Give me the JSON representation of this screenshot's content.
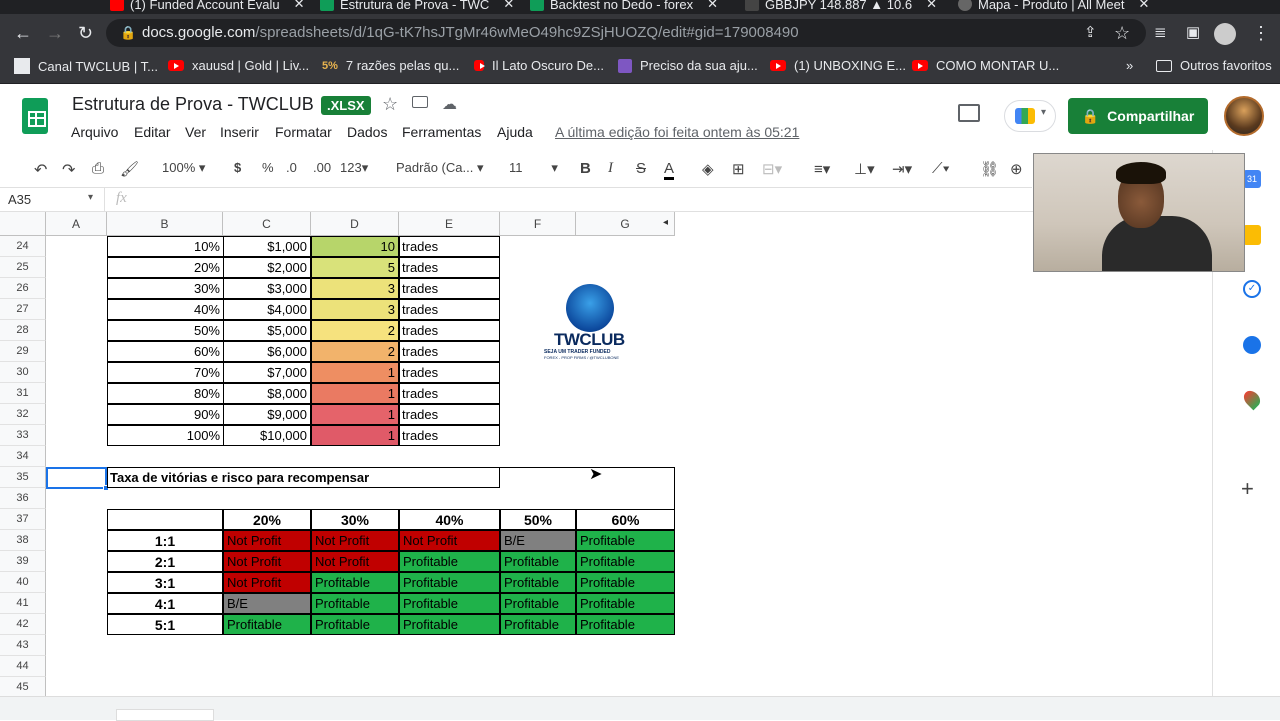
{
  "browser": {
    "tabs": [
      {
        "label": "(1) Funded Account Evalu",
        "color": "#ff0000"
      },
      {
        "label": "Estrutura de Prova - TWC",
        "color": "#0f9d58"
      },
      {
        "label": "Backtest no Dedo - forex",
        "color": "#0f9d58"
      },
      {
        "label": "GBBJPY 148.887 ▲ 10.6",
        "color": "#ffffff"
      },
      {
        "label": "Mapa - Produto | All Meet",
        "color": "#ffffff"
      }
    ],
    "url_host": "docs.google.com",
    "url_path": "/spreadsheets/d/1qG-tK7hsJTgMr46wMeO49hc9ZSjHUOZQ/edit#gid=179008490",
    "bookmarks": [
      "Canal TWCLUB | T...",
      "xauusd | Gold | Liv...",
      "7 razões pelas qu...",
      "Il Lato Oscuro De...",
      "Preciso da sua aju...",
      "(1) UNBOXING E...",
      "COMO MONTAR U..."
    ],
    "bookmarks_more": "»",
    "other_favorites": "Outros favoritos"
  },
  "sheet": {
    "title": "Estrutura de Prova - TWCLUB",
    "badge": ".XLSX",
    "menus": [
      "Arquivo",
      "Editar",
      "Ver",
      "Inserir",
      "Formatar",
      "Dados",
      "Ferramentas",
      "Ajuda"
    ],
    "last_edit": "A última edição foi feita ontem às 05:21",
    "share_label": "Compartilhar",
    "toolbar": {
      "zoom": "100%",
      "currency": "$",
      "percent": "%",
      "dec_dec": ".0",
      "dec_inc": ".00",
      "format_more": "123",
      "font": "Padrão (Ca...",
      "font_size": "11",
      "bold": "B",
      "italic": "I",
      "strike": "S",
      "textcolor": "A"
    },
    "name_box": "A35",
    "fx": "fx"
  },
  "grid": {
    "columns": [
      "A",
      "B",
      "C",
      "D",
      "E",
      "F",
      "G"
    ],
    "rows": [
      "24",
      "25",
      "26",
      "27",
      "28",
      "29",
      "30",
      "31",
      "32",
      "33",
      "34",
      "35",
      "36",
      "37",
      "38",
      "39",
      "40",
      "41",
      "42",
      "43",
      "44",
      "45"
    ],
    "risk_table": [
      {
        "pct": "10%",
        "amount": "$1,000",
        "trades": "10",
        "unit": "trades",
        "color": "#b7d56a"
      },
      {
        "pct": "20%",
        "amount": "$2,000",
        "trades": "5",
        "unit": "trades",
        "color": "#d9e27a"
      },
      {
        "pct": "30%",
        "amount": "$3,000",
        "trades": "3",
        "unit": "trades",
        "color": "#ece27a"
      },
      {
        "pct": "40%",
        "amount": "$4,000",
        "trades": "3",
        "unit": "trades",
        "color": "#ece27a"
      },
      {
        "pct": "50%",
        "amount": "$5,000",
        "trades": "2",
        "unit": "trades",
        "color": "#f6e27e"
      },
      {
        "pct": "60%",
        "amount": "$6,000",
        "trades": "2",
        "unit": "trades",
        "color": "#f2b36b"
      },
      {
        "pct": "70%",
        "amount": "$7,000",
        "trades": "1",
        "unit": "trades",
        "color": "#ee8e62"
      },
      {
        "pct": "80%",
        "amount": "$8,000",
        "trades": "1",
        "unit": "trades",
        "color": "#ea7a62"
      },
      {
        "pct": "90%",
        "amount": "$9,000",
        "trades": "1",
        "unit": "trades",
        "color": "#e5636a"
      },
      {
        "pct": "100%",
        "amount": "$10,000",
        "trades": "1",
        "unit": "trades",
        "color": "#e05a68"
      }
    ],
    "section_title": "Taxa de vitórias e risco para recompensar",
    "winrate_headers": [
      "20%",
      "30%",
      "40%",
      "50%",
      "60%"
    ],
    "rr_rows": [
      {
        "label": "1:1",
        "cells": [
          {
            "text": "Not Profit",
            "color": "#c00000"
          },
          {
            "text": "Not Profit",
            "color": "#c00000"
          },
          {
            "text": "Not Profit",
            "color": "#c00000"
          },
          {
            "text": "B/E",
            "color": "#808080"
          },
          {
            "text": "Profitable",
            "color": "#1fb24a"
          }
        ]
      },
      {
        "label": "2:1",
        "cells": [
          {
            "text": "Not Profit",
            "color": "#c00000"
          },
          {
            "text": "Not Profit",
            "color": "#c00000"
          },
          {
            "text": "Profitable",
            "color": "#1fb24a"
          },
          {
            "text": "Profitable",
            "color": "#1fb24a"
          },
          {
            "text": "Profitable",
            "color": "#1fb24a"
          }
        ]
      },
      {
        "label": "3:1",
        "cells": [
          {
            "text": "Not Profit",
            "color": "#c00000"
          },
          {
            "text": "Profitable",
            "color": "#1fb24a"
          },
          {
            "text": "Profitable",
            "color": "#1fb24a"
          },
          {
            "text": "Profitable",
            "color": "#1fb24a"
          },
          {
            "text": "Profitable",
            "color": "#1fb24a"
          }
        ]
      },
      {
        "label": "4:1",
        "cells": [
          {
            "text": "B/E",
            "color": "#808080"
          },
          {
            "text": "Profitable",
            "color": "#1fb24a"
          },
          {
            "text": "Profitable",
            "color": "#1fb24a"
          },
          {
            "text": "Profitable",
            "color": "#1fb24a"
          },
          {
            "text": "Profitable",
            "color": "#1fb24a"
          }
        ]
      },
      {
        "label": "5:1",
        "cells": [
          {
            "text": "Profitable",
            "color": "#1fb24a"
          },
          {
            "text": "Profitable",
            "color": "#1fb24a"
          },
          {
            "text": "Profitable",
            "color": "#1fb24a"
          },
          {
            "text": "Profitable",
            "color": "#1fb24a"
          },
          {
            "text": "Profitable",
            "color": "#1fb24a"
          }
        ]
      }
    ],
    "logo": {
      "name": "TWCLUB",
      "tagline": "SEJA UM TRADER FUNDED",
      "subtag": "FOREX - PROP FIRMS / @TWCLUBONE"
    }
  }
}
